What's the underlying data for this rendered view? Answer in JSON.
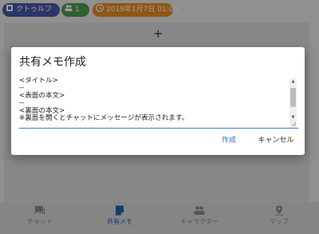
{
  "topbar": {
    "room": {
      "label": "クトゥルフ",
      "icon": "room-icon"
    },
    "users": {
      "count": "1",
      "icon": "people-icon"
    },
    "datetime": {
      "label": "2019年1月7日 01:05",
      "icon": "clock-icon"
    }
  },
  "background": {
    "add_symbol": "+"
  },
  "dialog": {
    "title": "共有メモ作成",
    "memo_text": "<タイトル>\n--\n<表面の本文>\n--\n<裏面の本文>\n※裏面を開くとチャットにメッセージが表示されます。",
    "create_label": "作成",
    "cancel_label": "キャンセル"
  },
  "bottom_nav": {
    "items": [
      {
        "label": "チャット",
        "icon": "chat-icon",
        "active": false
      },
      {
        "label": "共有メモ",
        "icon": "memo-icon",
        "active": true
      },
      {
        "label": "キャラクター",
        "icon": "character-icon",
        "active": false
      },
      {
        "label": "マップ",
        "icon": "map-icon",
        "active": false
      }
    ]
  },
  "colors": {
    "room_chip": "#4a58a8",
    "users_chip": "#4d9c4f",
    "time_chip": "#e78a24",
    "accent": "#2f6fc4"
  }
}
